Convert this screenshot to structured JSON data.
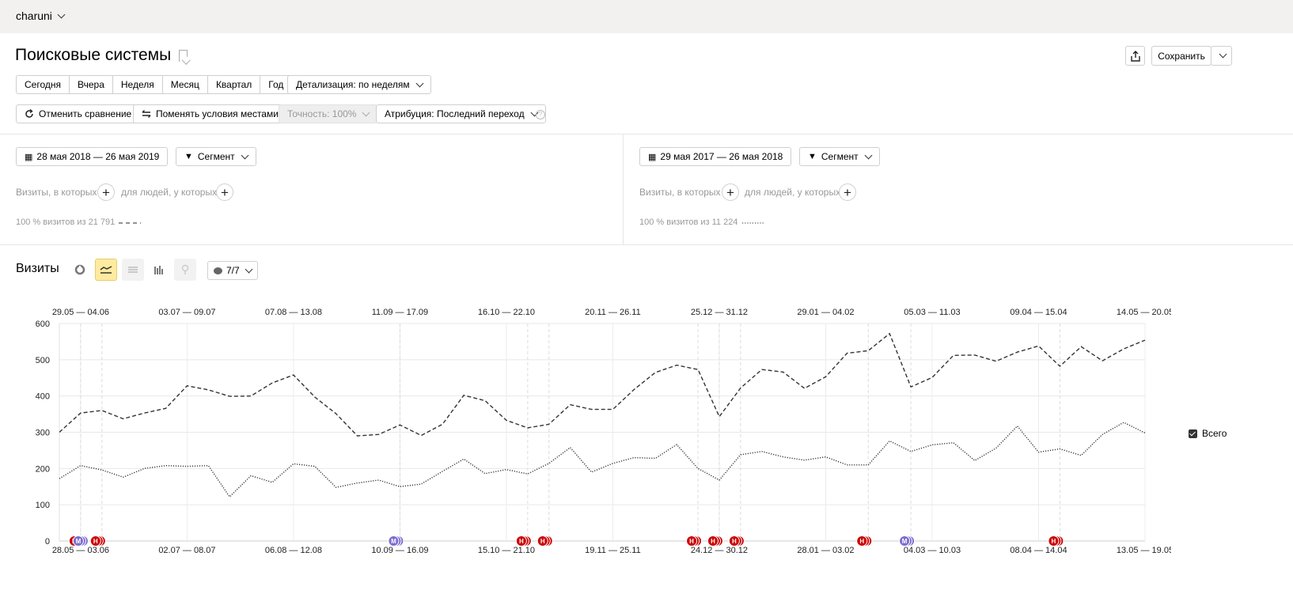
{
  "account": {
    "name": "charuni"
  },
  "page": {
    "title": "Поисковые системы"
  },
  "toolbar": {
    "save_label": "Сохранить"
  },
  "period_buttons": [
    "Сегодня",
    "Вчера",
    "Неделя",
    "Месяц",
    "Квартал",
    "Год"
  ],
  "detail_select": "Детализация: по неделям",
  "actions": {
    "cancel_compare": "Отменить сравнение",
    "swap_conditions": "Поменять условия местами",
    "accuracy": "Точность: 100%",
    "attribution": "Атрибуция: Последний переход"
  },
  "segments": [
    {
      "date_range": "28 мая 2018 — 26 мая 2019",
      "segment_label": "Сегмент",
      "visits_label": "Визиты, в которых",
      "people_label": "для людей, у которых",
      "summary": "100 % визитов из 21 791"
    },
    {
      "date_range": "29 мая 2017 — 26 мая 2018",
      "segment_label": "Сегмент",
      "visits_label": "Визиты, в которых",
      "people_label": "для людей, у которых",
      "summary": "100 % визитов из 11 224"
    }
  ],
  "chart_section": {
    "title": "Визиты",
    "notes_count": "7/7",
    "legend_label": "Всего"
  },
  "chart_data": {
    "type": "line",
    "ylim": [
      0,
      600
    ],
    "y_ticks": [
      "0",
      "100",
      "200",
      "300",
      "400",
      "500",
      "600"
    ],
    "top_axis_labels": [
      "29.05 — 04.06",
      "03.07 — 09.07",
      "07.08 — 13.08",
      "11.09 — 17.09",
      "16.10 — 22.10",
      "20.11 — 26.11",
      "25.12 — 31.12",
      "29.01 — 04.02",
      "05.03 — 11.03",
      "09.04 — 15.04",
      "14.05 — 20.05"
    ],
    "bottom_axis_labels": [
      "28.05 — 03.06",
      "02.07 — 08.07",
      "06.08 — 12.08",
      "10.09 — 16.09",
      "15.10 — 21.10",
      "19.11 — 25.11",
      "24.12 — 30.12",
      "28.01 — 03.02",
      "04.03 — 10.03",
      "08.04 — 14.04",
      "13.05 — 19.05"
    ],
    "series": [
      {
        "name": "28 мая 2018 — 26 мая 2019",
        "style": "dashed",
        "values": [
          300,
          353,
          360,
          337,
          353,
          366,
          428,
          417,
          399,
          400,
          436,
          458,
          397,
          351,
          290,
          294,
          320,
          291,
          322,
          402,
          387,
          333,
          312,
          322,
          376,
          363,
          363,
          418,
          465,
          485,
          473,
          343,
          422,
          473,
          466,
          421,
          453,
          518,
          525,
          572,
          425,
          451,
          512,
          513,
          496,
          521,
          538,
          482,
          536,
          497,
          530,
          554
        ]
      },
      {
        "name": "29 мая 2017 — 26 мая 2018",
        "style": "dotted",
        "values": [
          172,
          208,
          196,
          176,
          200,
          208,
          206,
          208,
          122,
          180,
          162,
          213,
          206,
          148,
          160,
          168,
          150,
          157,
          192,
          226,
          186,
          197,
          185,
          214,
          258,
          190,
          214,
          230,
          228,
          266,
          200,
          168,
          238,
          247,
          232,
          223,
          232,
          210,
          210,
          276,
          247,
          265,
          271,
          222,
          256,
          317,
          245,
          254,
          236,
          294,
          327,
          298
        ]
      }
    ],
    "annotations": [
      {
        "week": 1,
        "label": "Н",
        "color": "#cc0000"
      },
      {
        "week": 1,
        "label": "М",
        "color": "#7c6cd0"
      },
      {
        "week": 2,
        "label": "Н",
        "color": "#cc0000"
      },
      {
        "week": 16,
        "label": "М",
        "color": "#7c6cd0"
      },
      {
        "week": 22,
        "label": "Н",
        "color": "#cc0000"
      },
      {
        "week": 23,
        "label": "Н",
        "color": "#cc0000"
      },
      {
        "week": 30,
        "label": "Н",
        "color": "#cc0000"
      },
      {
        "week": 31,
        "label": "Н",
        "color": "#cc0000"
      },
      {
        "week": 32,
        "label": "Н",
        "color": "#cc0000"
      },
      {
        "week": 38,
        "label": "Н",
        "color": "#cc0000"
      },
      {
        "week": 40,
        "label": "М",
        "color": "#7c6cd0"
      },
      {
        "week": 47,
        "label": "Н",
        "color": "#cc0000"
      }
    ]
  }
}
